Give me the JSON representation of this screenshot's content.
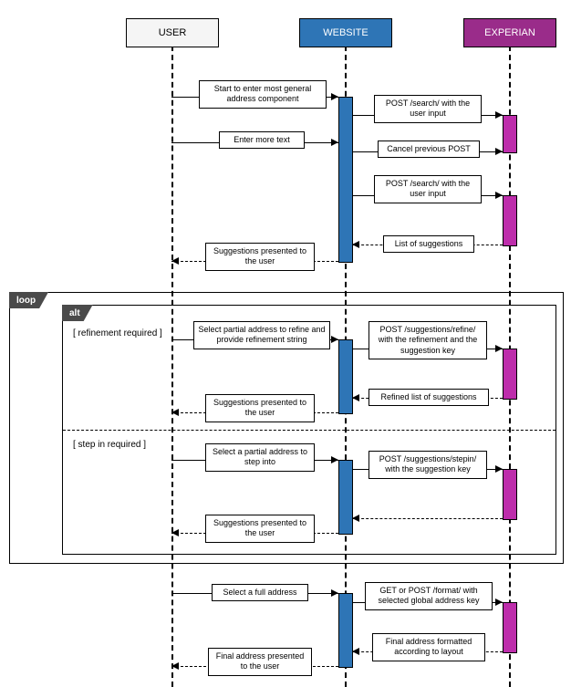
{
  "actors": {
    "user": "USER",
    "website": "WEBSITE",
    "experian": "EXPERIAN"
  },
  "frames": {
    "loop": "loop",
    "alt": "alt"
  },
  "guards": {
    "refine": "[ refinement required ]",
    "stepin": "[ step in required ]"
  },
  "messages": {
    "m1": "Start to enter most general address component",
    "m2": "POST /search/ with the user input",
    "m3": "Enter more text",
    "m4": "Cancel previous POST",
    "m5": "POST /search/ with the user input",
    "m6": "List of suggestions",
    "m7": "Suggestions presented to the user",
    "m8": "Select partial address to refine and provide refinement string",
    "m9": "POST /suggestions/refine/ with the refinement and the suggestion key",
    "m10": "Refined list of suggestions",
    "m11": "Suggestions presented to the user",
    "m12": "Select a partial address to step into",
    "m13": "POST /suggestions/stepin/ with the suggestion key",
    "m14": "",
    "m15": "Suggestions presented to the user",
    "m16": "Select a full address",
    "m17": "GET or POST /format/ with selected global address key",
    "m18": "Final address formatted according to layout",
    "m19": "Final address presented to the user"
  }
}
